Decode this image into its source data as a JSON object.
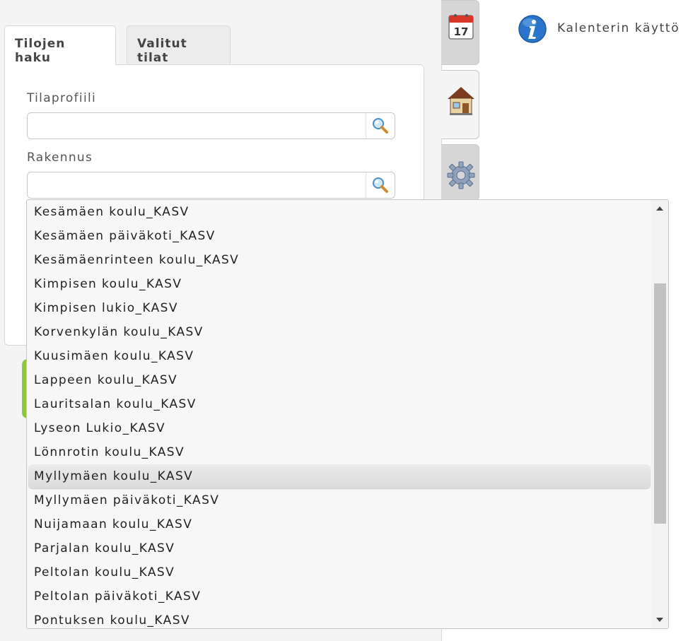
{
  "tabs": [
    {
      "label": "Tilojen haku",
      "active": true
    },
    {
      "label": "Valitut tilat",
      "active": false
    }
  ],
  "form": {
    "space_profile": {
      "label": "Tilaprofiili",
      "value": ""
    },
    "building": {
      "label": "Rakennus",
      "value": ""
    }
  },
  "side_tabs": [
    {
      "icon": "calendar-icon",
      "text": "17"
    },
    {
      "icon": "house-icon"
    },
    {
      "icon": "gear-icon"
    }
  ],
  "info": {
    "icon": "info-icon",
    "text": "Kalenterin käyttö"
  },
  "dropdown": {
    "items": [
      "Kesämäen koulu_KASV",
      "Kesämäen päiväkoti_KASV",
      "Kesämäenrinteen koulu_KASV",
      "Kimpisen koulu_KASV",
      "Kimpisen lukio_KASV",
      "Korvenkylän koulu_KASV",
      "Kuusimäen koulu_KASV",
      "Lappeen koulu_KASV",
      "Lauritsalan koulu_KASV",
      "Lyseon Lukio_KASV",
      "Lönnrotin koulu_KASV",
      "Myllymäen koulu_KASV",
      "Myllymäen päiväkoti_KASV",
      "Nuijamaan koulu_KASV",
      "Parjalan koulu_KASV",
      "Peltolan koulu_KASV",
      "Peltolan päiväkoti_KASV",
      "Pontuksen koulu_KASV"
    ],
    "highlighted": "Myllymäen koulu_KASV"
  },
  "colors": {
    "accent_green": "#8ec63f",
    "info_blue": "#2a74c9"
  }
}
